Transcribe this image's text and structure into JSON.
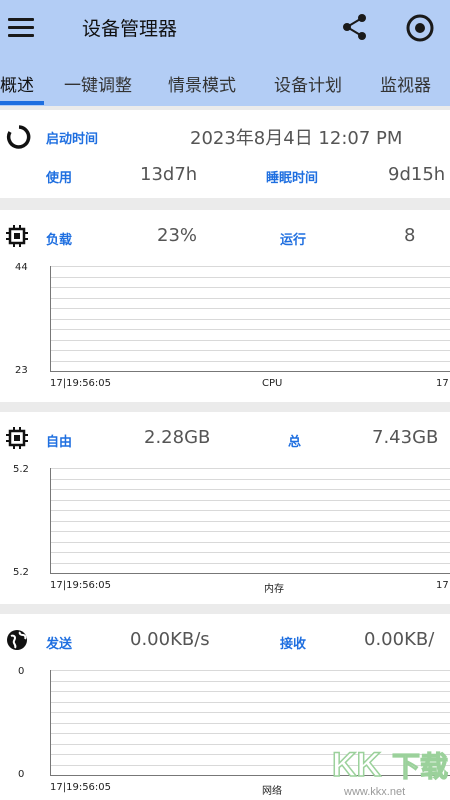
{
  "app": {
    "title": "设备管理器"
  },
  "tabs": [
    {
      "label": "概述",
      "active": true
    },
    {
      "label": "一键调整"
    },
    {
      "label": "情景模式"
    },
    {
      "label": "设备计划"
    },
    {
      "label": "监视器"
    }
  ],
  "uptime": {
    "boot_label": "启动时间",
    "boot_value": "2023年8月4日 12:07 PM",
    "use_label": "使用",
    "use_value": "13d7h",
    "sleep_label": "睡眠时间",
    "sleep_value": "9d15h"
  },
  "cpu": {
    "load_label": "负载",
    "load_value": "23%",
    "run_label": "运行",
    "run_value": "8",
    "y_max": "44",
    "y_min": "23",
    "x_start": "17|19:56:05",
    "x_title": "CPU",
    "x_end": "17|"
  },
  "memory": {
    "free_label": "自由",
    "free_value": "2.28GB",
    "total_label": "总",
    "total_value": "7.43GB",
    "y_max": "5.2",
    "y_min": "5.2",
    "x_start": "17|19:56:05",
    "x_title": "内存",
    "x_end": "17|"
  },
  "network": {
    "send_label": "发送",
    "send_value": "0.00KB/s",
    "recv_label": "接收",
    "recv_value": "0.00KB/",
    "y_max": "0",
    "y_min": "0",
    "x_start": "17|19:56:05",
    "x_title": "网络"
  },
  "watermark": {
    "brand": "KK下载",
    "url": "www.kkx.net"
  },
  "colors": {
    "appbar": "#b3cdf5",
    "accent": "#1f6fe0"
  }
}
